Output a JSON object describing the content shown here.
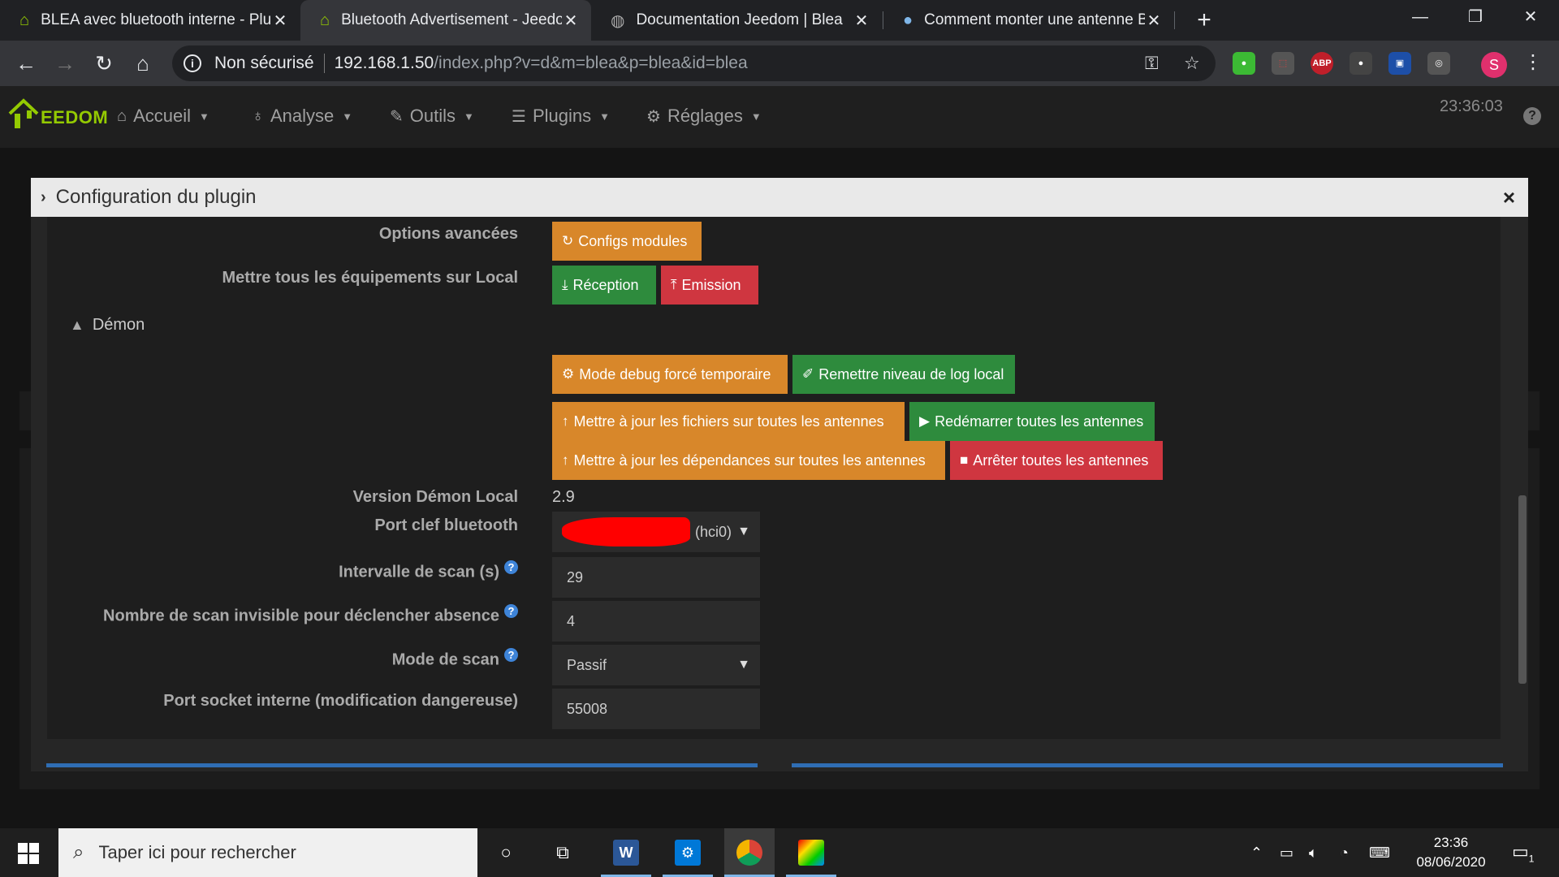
{
  "browser": {
    "tabs": [
      {
        "title": "BLEA avec bluetooth interne - Plu",
        "close": "✕",
        "icon": "jeedom-icon",
        "active": false
      },
      {
        "title": "Bluetooth Advertisement - Jeedo",
        "close": "✕",
        "icon": "jeedom-icon",
        "active": true
      },
      {
        "title": "Documentation Jeedom | Blea",
        "close": "✕",
        "icon": "globe-icon",
        "active": false
      },
      {
        "title": "Comment monter une antenne B",
        "close": "✕",
        "icon": "site-icon",
        "active": false
      }
    ],
    "new_tab": "+",
    "security_label": "Non sécurisé",
    "url_host": "192.168.1.50",
    "url_path": "/index.php?v=d&m=blea&p=blea&id=blea",
    "profile_initial": "S",
    "extensions": [
      "green-ext",
      "pdf-ext",
      "ABP",
      "puzzle-ext",
      "screen-ext",
      "glasses-ext"
    ]
  },
  "jeedom": {
    "logo_text": "EEDOM",
    "menu": [
      {
        "label": "Accueil",
        "icon": "home-icon"
      },
      {
        "label": "Analyse",
        "icon": "stethoscope-icon"
      },
      {
        "label": "Outils",
        "icon": "wrench-icon"
      },
      {
        "label": "Plugins",
        "icon": "list-icon"
      },
      {
        "label": "Réglages",
        "icon": "gear-icon"
      }
    ],
    "time": "23:36:03",
    "help": "?"
  },
  "modal": {
    "title": "Configuration du plugin",
    "close": "×",
    "advanced_label": "Options avancées",
    "configs_button": "Configs modules",
    "local_label": "Mettre tous les équipements sur Local",
    "reception_button": "Réception",
    "emission_button": "Emission",
    "daemon_title": "Démon",
    "debug_button": "Mode debug forcé temporaire",
    "loglevel_button": "Remettre niveau de log local",
    "update_files_button": "Mettre à jour les fichiers sur toutes les antennes",
    "restart_button": "Redémarrer toutes les antennes",
    "update_deps_button": "Mettre à jour les dépendances sur toutes les antennes",
    "stop_button": "Arrêter toutes les antennes",
    "version_label": "Version Démon Local",
    "version_value": "2.9",
    "port_label": "Port clef bluetooth",
    "port_value": "(hci0)",
    "scan_interval_label": "Intervalle de scan (s)",
    "scan_interval_value": "29",
    "absence_label": "Nombre de scan invisible pour déclencher absence",
    "absence_value": "4",
    "scan_mode_label": "Mode de scan",
    "scan_mode_value": "Passif",
    "socket_label": "Port socket interne (modification dangereuse)",
    "socket_value": "55008"
  },
  "taskbar": {
    "search_placeholder": "Taper ici pour rechercher",
    "time": "23:36",
    "date": "08/06/2020",
    "notif_count": "1"
  },
  "colors": {
    "orange": "#d8872a",
    "green": "#2e8b3d",
    "red": "#cf3640",
    "jeedom_green": "#94ca02",
    "help_blue": "#3e84d8"
  }
}
